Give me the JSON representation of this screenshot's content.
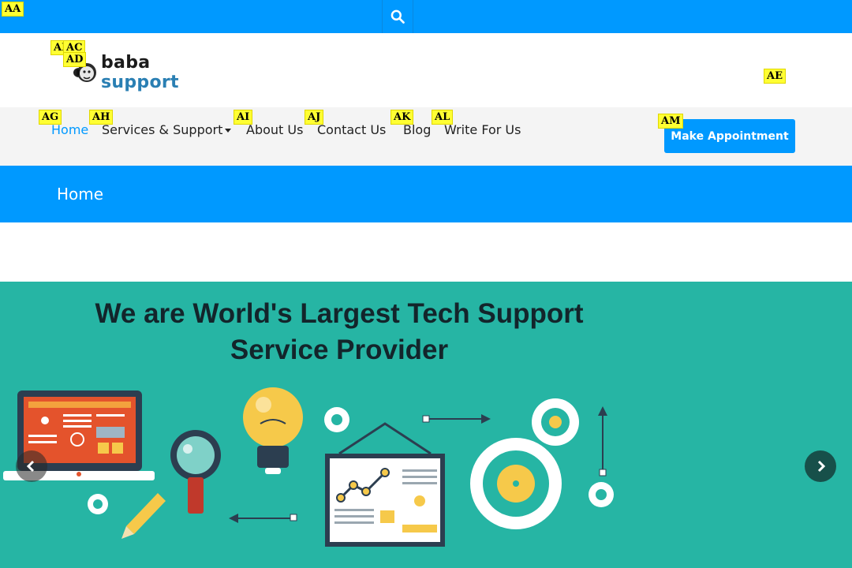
{
  "topbar": {
    "search_icon": "search-icon"
  },
  "header": {
    "logo": {
      "part1": "baba",
      "part2": "support"
    }
  },
  "nav": {
    "items": [
      {
        "label": "Home",
        "active": true
      },
      {
        "label": "Services & Support",
        "dropdown": true
      },
      {
        "label": "About Us"
      },
      {
        "label": "Contact Us"
      },
      {
        "label": "Blog"
      },
      {
        "label": "Write For Us"
      }
    ],
    "cta_label": "Make Appointment"
  },
  "page": {
    "title": "Home"
  },
  "hero": {
    "title": "We are World's Largest Tech Support Service Provider",
    "prev_icon": "chevron-left-icon",
    "next_icon": "chevron-right-icon"
  },
  "tags": {
    "AA": "AA",
    "AB": "AB",
    "AC": "AC",
    "AD": "AD",
    "AE": "AE",
    "AG": "AG",
    "AH": "AH",
    "AI": "AI",
    "AJ": "AJ",
    "AK": "AK",
    "AL": "AL",
    "AM": "AM"
  },
  "colors": {
    "primary": "#0099ff",
    "hero_bg": "#26b5a4",
    "nav_bg": "#f4f4f4",
    "text_dark": "#13252b"
  }
}
